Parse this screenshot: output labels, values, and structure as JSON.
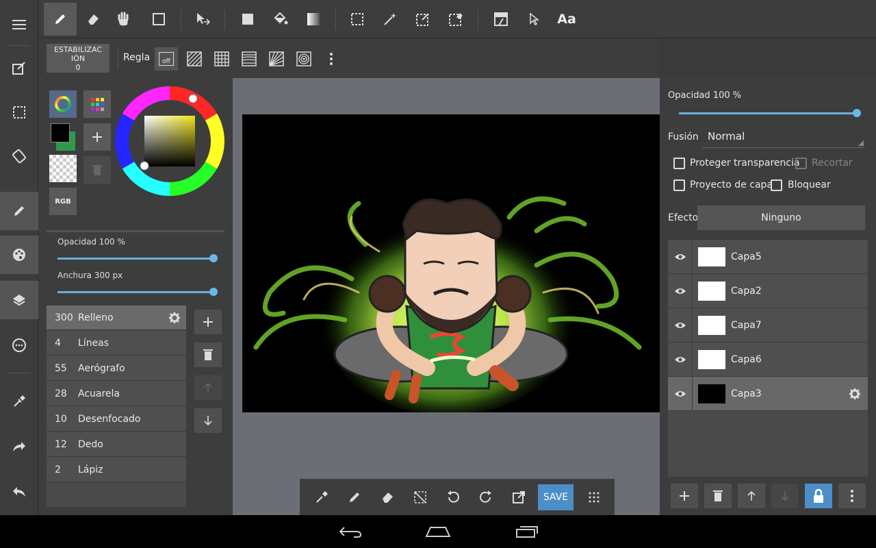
{
  "colors": {
    "accent": "#4c8ec8",
    "slider": "#6ab8e8"
  },
  "left_rail": {
    "items": [
      {
        "icon": "menu-icon"
      },
      {
        "icon": "edit-canvas-icon"
      },
      {
        "icon": "selection-icon"
      },
      {
        "icon": "rotate-canvas-icon"
      },
      {
        "icon": "brush-icon"
      },
      {
        "icon": "palette-icon"
      },
      {
        "icon": "layers-icon"
      },
      {
        "icon": "more-circle-icon"
      },
      {
        "icon": "eyedropper-icon"
      },
      {
        "icon": "redo-icon"
      },
      {
        "icon": "undo-icon"
      }
    ]
  },
  "toolbar": {
    "text_tool_label": "Aa",
    "icons": [
      "pen-icon",
      "eraser-icon",
      "hand-icon",
      "rect-icon",
      "move-icon",
      "fill-rect-icon",
      "bucket-icon",
      "gradient-icon",
      "select-rect-icon",
      "magic-wand-icon",
      "select-pen-icon",
      "select-eraser-icon",
      "transform-icon",
      "pointer-icon"
    ]
  },
  "subbar": {
    "stabilizer_label": "ESTABILIZACIÓN",
    "stabilizer_value": "0",
    "ruler_label": "Regla",
    "ruler_off_label": "off"
  },
  "color_panel": {
    "rgb_label": "RGB",
    "opacity_label": "Opacidad 100 %",
    "opacity_value": 1.0,
    "width_label": "Anchura 300 px",
    "width_value": 1.0,
    "primary_color": "#000000",
    "secondary_color": "#2e9a4a"
  },
  "brushes": [
    {
      "size": "300",
      "name": "Relleno",
      "selected": true
    },
    {
      "size": "4",
      "name": "Líneas"
    },
    {
      "size": "55",
      "name": "Aerógrafo"
    },
    {
      "size": "28",
      "name": "Acuarela"
    },
    {
      "size": "10",
      "name": "Desenfocado"
    },
    {
      "size": "12",
      "name": "Dedo"
    },
    {
      "size": "2",
      "name": "Lápiz"
    }
  ],
  "bottom_bar": {
    "save_label": "SAVE"
  },
  "layer_panel": {
    "opacity_label": "Opacidad 100 %",
    "opacity_value": 1.0,
    "blend_label": "Fusión",
    "blend_value": "Normal",
    "protect_transparency": "Proteger transparencia",
    "clip": "Recortar",
    "layer_draft": "Proyecto de capa",
    "lock": "Bloquear",
    "effect_label": "Efecto",
    "effect_value": "Ninguno",
    "layers": [
      {
        "name": "Capa5",
        "thumb": "#ffffff"
      },
      {
        "name": "Capa2",
        "thumb": "#ffffff"
      },
      {
        "name": "Capa7",
        "thumb": "#ffffff"
      },
      {
        "name": "Capa6",
        "thumb": "#ffffff"
      },
      {
        "name": "Capa3",
        "thumb": "#000000",
        "selected": true
      }
    ]
  }
}
